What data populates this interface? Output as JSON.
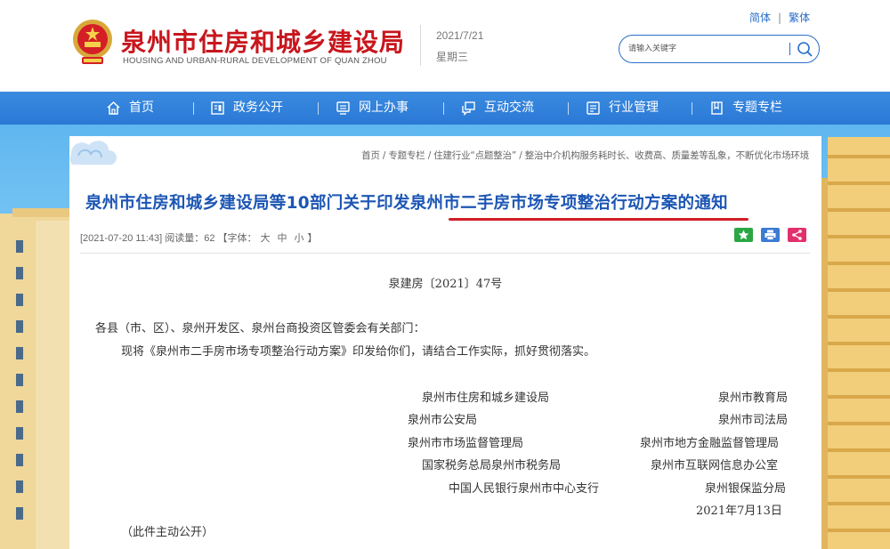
{
  "header": {
    "title": "泉州市住房和城乡建设局",
    "subtitle": "HOUSING AND URBAN-RURAL DEVELOPMENT OF QUAN ZHOU",
    "date": "2021/7/21",
    "weekday": "星期三",
    "lang_simplified": "简体",
    "lang_separator": "|",
    "lang_traditional": "繁体",
    "search_placeholder": "请输入关键字"
  },
  "nav": {
    "items": [
      {
        "label": "首页",
        "icon": "home-icon"
      },
      {
        "label": "政务公开",
        "icon": "document-icon"
      },
      {
        "label": "网上办事",
        "icon": "monitor-icon"
      },
      {
        "label": "互动交流",
        "icon": "chat-icon"
      },
      {
        "label": "行业管理",
        "icon": "list-icon"
      },
      {
        "label": "专题专栏",
        "icon": "bookmark-icon"
      }
    ]
  },
  "article": {
    "breadcrumb": "首页 / 专题专栏 / 住建行业“点题整治” / 整治中介机构服务耗时长、收费高、质量差等乱象，不断优化市场环境",
    "title": "泉州市住房和城乡建设局等10部门关于印发泉州市二手房市场专项整治行动方案的通知",
    "meta_prefix": "[2021-07-20 11:43] 阅读量：62 【字体：",
    "font_large": "大",
    "font_medium": "中",
    "font_small": "小",
    "meta_suffix": "】",
    "doc_number": "泉建房〔2021〕47号",
    "salutation": "各县（市、区）、泉州开发区、泉州台商投资区管委会有关部门：",
    "body": "现将《泉州市二手房市场专项整治行动方案》印发给你们，请结合工作实际，抓好贯彻落实。",
    "signatories_left": [
      "泉州市住房和城乡建设局",
      "泉州市公安局",
      "泉州市市场监督管理局",
      "国家税务总局泉州市税务局",
      "中国人民银行泉州市中心支行"
    ],
    "signatories_right": [
      "泉州市教育局",
      "泉州市司法局",
      "泉州市地方金融监督管理局",
      "泉州市互联网信息办公室",
      "泉州银保监分局"
    ],
    "sign_date": "2021年7月13日",
    "disclosure": "（此件主动公开）"
  },
  "colors": {
    "brand_red": "#c8161d",
    "nav_blue": "#2a78d6",
    "title_blue": "#1c56b4",
    "share_green": "#2aa744",
    "share_blue": "#3b7bd4",
    "share_pink": "#e2306c"
  }
}
